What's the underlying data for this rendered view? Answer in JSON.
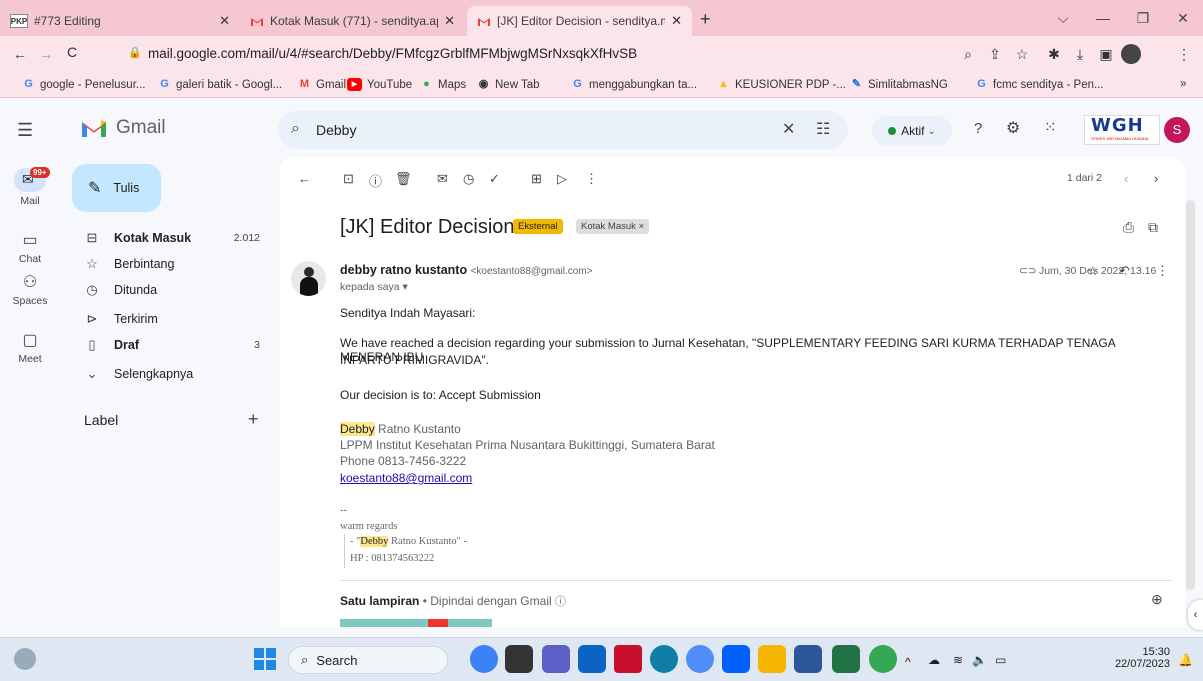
{
  "browser": {
    "tabs": [
      {
        "favicon": "PKP",
        "title": "#773 Editing"
      },
      {
        "favicon": "gmail-icon",
        "title": "Kotak Masuk (771) - senditya.ap"
      },
      {
        "favicon": "gmail-icon",
        "title": "[JK] Editor Decision - senditya.m"
      }
    ],
    "url": "mail.google.com/mail/u/4/#search/Debby/FMfcgzGrblfMFMbjwgMSrNxsqkXfHvSB",
    "bookmarks": [
      "google - Penelusur...",
      "galeri batik - Googl...",
      "Gmail",
      "YouTube",
      "Maps",
      "New Tab",
      "menggabungkan ta...",
      "KEUSIONER PDP -...",
      "SimlitabmasNG",
      "fcmc senditya - Pen..."
    ],
    "bookmarks_more": "»"
  },
  "gmail": {
    "logo_text": "Gmail",
    "search_value": "Debby",
    "status": "Aktif",
    "account_initial": "S",
    "org_badge": "WGH",
    "org_sub": "STIKES WIDYAGAMA HUSADA",
    "rail": [
      {
        "label": "Mail",
        "badge": "99+"
      },
      {
        "label": "Chat"
      },
      {
        "label": "Spaces"
      },
      {
        "label": "Meet"
      }
    ],
    "compose_label": "Tulis",
    "nav": [
      {
        "label": "Kotak Masuk",
        "count": "2.012",
        "bold": true
      },
      {
        "label": "Berbintang",
        "count": ""
      },
      {
        "label": "Ditunda",
        "count": ""
      },
      {
        "label": "Terkirim",
        "count": ""
      },
      {
        "label": "Draf",
        "count": "3",
        "bold": true
      },
      {
        "label": "Selengkapnya",
        "count": ""
      }
    ],
    "labels_heading": "Label",
    "labels_add": "+"
  },
  "message": {
    "pager": "1 dari 2",
    "subject": "[JK] Editor Decision",
    "tag_external": "Eksternal",
    "tag_inbox": "Kotak Masuk",
    "tag_inbox_close": "×",
    "sender_name": "debby ratno kustanto",
    "sender_email": "<koestanto88@gmail.com>",
    "to_line": "kepada saya",
    "date": "Jum, 30 Des 2022, 13.16",
    "greeting": "Senditya Indah Mayasari:",
    "body_1": "We have reached a decision regarding your submission to Jurnal Kesehatan, \"SUPPLEMENTARY FEEDING SARI KURMA TERHADAP TENAGA MENERAN IBU",
    "body_2": "INPARTU PRIMIGRAVIDA\".",
    "decision": "Our decision is to: Accept Submission",
    "sig_first": "Debby",
    "sig_rest": " Ratno Kustanto",
    "sig_inst": "LPPM Institut Kesehatan Prima Nusantara Bukittinggi, Sumatera Barat",
    "sig_phone": "Phone 0813-7456-3222",
    "sig_email": "koestanto88@gmail.com",
    "sig_dash": "--",
    "sig2_regards": "warm regards",
    "sig2_prefix": "- \"",
    "sig2_first": "Debby",
    "sig2_rest": " Ratno Kustanto\" -",
    "sig2_hp": "HP : 081374563222",
    "attachment_label": "Satu lampiran",
    "attachment_scan": "• Dipindai dengan Gmail"
  },
  "taskbar": {
    "search_label": "Search",
    "time": "15:30",
    "date": "22/07/2023"
  },
  "colors": {
    "tab_strip": "#f4c7d3",
    "external_tag": "#f2b900",
    "highlight": "#fce78d",
    "gmail_red": "#ea4335",
    "avatar": "#c2185b"
  }
}
